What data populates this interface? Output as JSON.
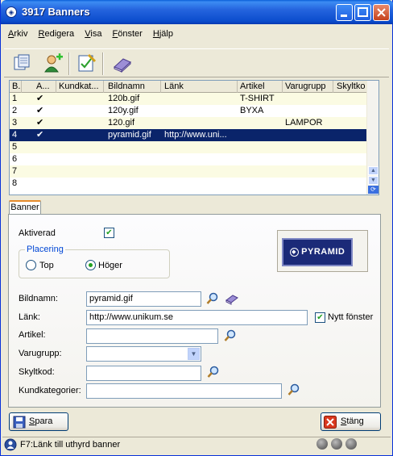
{
  "window": {
    "title": "3917 Banners"
  },
  "menu": {
    "items": [
      {
        "label": "Arkiv",
        "accel": "A",
        "rest": "rkiv"
      },
      {
        "label": "Redigera",
        "accel": "R",
        "rest": "edigera"
      },
      {
        "label": "Visa",
        "accel": "V",
        "rest": "isa"
      },
      {
        "label": "Fönster",
        "accel": "F",
        "rest": "önster"
      },
      {
        "label": "Hjälp",
        "accel": "H",
        "rest": "jälp"
      }
    ]
  },
  "toolbar": {
    "icons": [
      "copy-icon",
      "add-user-icon",
      "edit-icon",
      "book-icon"
    ]
  },
  "grid": {
    "headers": [
      "B...",
      "A...",
      "Kundkat...",
      "Bildnamn",
      "Länk",
      "Artikel",
      "Varugrupp",
      "Skyltko"
    ],
    "rows": [
      {
        "id": "1",
        "active": "✔",
        "kund": "",
        "bild": "120b.gif",
        "lank": "",
        "artikel": "T-SHIRT",
        "varugrupp": "",
        "skylt": ""
      },
      {
        "id": "2",
        "active": "✔",
        "kund": "",
        "bild": "120y.gif",
        "lank": "",
        "artikel": "BYXA",
        "varugrupp": "",
        "skylt": ""
      },
      {
        "id": "3",
        "active": "✔",
        "kund": "",
        "bild": "120.gif",
        "lank": "",
        "artikel": "",
        "varugrupp": "LAMPOR",
        "skylt": ""
      },
      {
        "id": "4",
        "active": "✔",
        "kund": "",
        "bild": "pyramid.gif",
        "lank": "http://www.uni...",
        "artikel": "",
        "varugrupp": "",
        "skylt": ""
      },
      {
        "id": "5",
        "active": "",
        "kund": "",
        "bild": "",
        "lank": "",
        "artikel": "",
        "varugrupp": "",
        "skylt": ""
      },
      {
        "id": "6",
        "active": "",
        "kund": "",
        "bild": "",
        "lank": "",
        "artikel": "",
        "varugrupp": "",
        "skylt": ""
      },
      {
        "id": "7",
        "active": "",
        "kund": "",
        "bild": "",
        "lank": "",
        "artikel": "",
        "varugrupp": "",
        "skylt": ""
      },
      {
        "id": "8",
        "active": "",
        "kund": "",
        "bild": "",
        "lank": "",
        "artikel": "",
        "varugrupp": "",
        "skylt": ""
      }
    ],
    "selected_index": 3
  },
  "tab": {
    "label": "Banner"
  },
  "form": {
    "aktiverad_label": "Aktiverad",
    "aktiverad_checked": true,
    "placering_title": "Placering",
    "top_label": "Top",
    "hoger_label": "Höger",
    "placering_value": "Höger",
    "bildnamn_label": "Bildnamn:",
    "bildnamn_value": "pyramid.gif",
    "lank_label": "Länk:",
    "lank_value": "http://www.unikum.se",
    "nytt_fonster_label": "Nytt fönster",
    "nytt_fonster_checked": true,
    "artikel_label": "Artikel:",
    "artikel_value": "",
    "varugrupp_label": "Varugrupp:",
    "varugrupp_value": "",
    "skyltkod_label": "Skyltkod:",
    "skyltkod_value": "",
    "kundkategorier_label": "Kundkategorier:",
    "kundkategorier_value": "",
    "preview_text": "PYRAMID"
  },
  "buttons": {
    "spara": {
      "accel": "S",
      "rest": "para"
    },
    "stang": {
      "accel": "S",
      "rest": "täng"
    }
  },
  "status": {
    "text": "F7:Länk till uthyrd banner"
  }
}
